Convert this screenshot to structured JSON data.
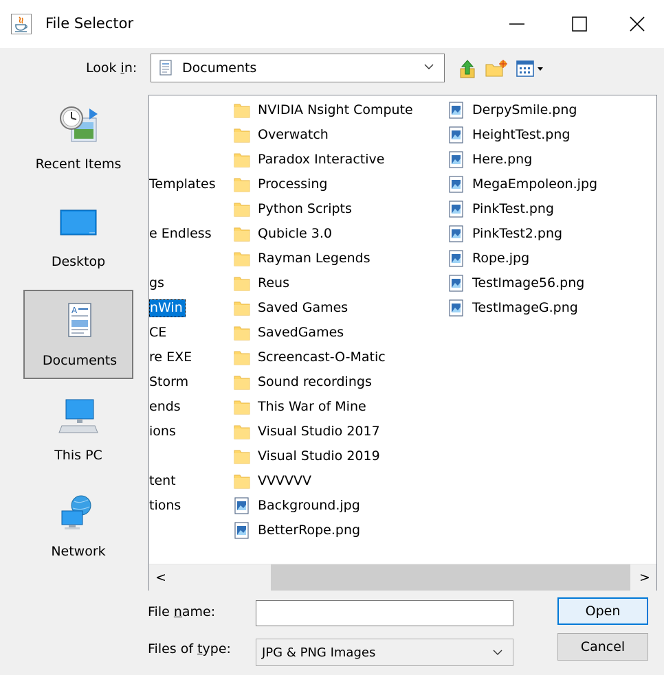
{
  "window": {
    "title": "File Selector",
    "minimize": "—",
    "maximize": "☐",
    "close": "✕"
  },
  "toolbar": {
    "look_in_pre": "Look ",
    "look_in_mnemonic": "i",
    "look_in_post": "n:",
    "look_in_value": "Documents",
    "icons": [
      "up-one-level-icon",
      "new-folder-icon",
      "view-menu-icon"
    ]
  },
  "places": [
    {
      "label": "Recent Items",
      "icon": "recent-items-icon"
    },
    {
      "label": "Desktop",
      "icon": "desktop-icon"
    },
    {
      "label": "Documents",
      "icon": "documents-icon",
      "selected": true
    },
    {
      "label": "This PC",
      "icon": "this-pc-icon"
    },
    {
      "label": "Network",
      "icon": "network-icon"
    }
  ],
  "file_list": {
    "partial_column": [
      {
        "text": " Templates",
        "y": 0
      },
      {
        "text": "e Endless",
        "y": 0
      },
      {
        "text": "gs",
        "y": 0
      },
      {
        "text": "nWin",
        "y": 0,
        "selected": true
      },
      {
        "text": "CE",
        "y": 0
      },
      {
        "text": "re EXE",
        "y": 0
      },
      {
        "text": "Storm",
        "y": 0
      },
      {
        "text": "ends",
        "y": 0
      },
      {
        "text": "ions",
        "y": 0
      },
      {
        "text": "tent",
        "y": 0
      },
      {
        "text": "tions",
        "y": 0
      }
    ],
    "column2": [
      {
        "name": "NVIDIA Nsight Compute",
        "type": "folder"
      },
      {
        "name": "Overwatch",
        "type": "folder"
      },
      {
        "name": "Paradox Interactive",
        "type": "folder"
      },
      {
        "name": "Processing",
        "type": "folder"
      },
      {
        "name": "Python Scripts",
        "type": "folder"
      },
      {
        "name": "Qubicle 3.0",
        "type": "folder"
      },
      {
        "name": "Rayman Legends",
        "type": "folder"
      },
      {
        "name": "Reus",
        "type": "folder"
      },
      {
        "name": "Saved Games",
        "type": "folder"
      },
      {
        "name": "SavedGames",
        "type": "folder"
      },
      {
        "name": "Screencast-O-Matic",
        "type": "folder"
      },
      {
        "name": "Sound recordings",
        "type": "folder"
      },
      {
        "name": "This War of Mine",
        "type": "folder"
      },
      {
        "name": "Visual Studio 2017",
        "type": "folder"
      },
      {
        "name": "Visual Studio 2019",
        "type": "folder"
      },
      {
        "name": "VVVVVV",
        "type": "folder"
      },
      {
        "name": "Background.jpg",
        "type": "image"
      },
      {
        "name": "BetterRope.png",
        "type": "image"
      }
    ],
    "column3": [
      {
        "name": "DerpySmile.png",
        "type": "image"
      },
      {
        "name": "HeightTest.png",
        "type": "image"
      },
      {
        "name": "Here.png",
        "type": "image"
      },
      {
        "name": "MegaEmpoleon.jpg",
        "type": "image"
      },
      {
        "name": "PinkTest.png",
        "type": "image"
      },
      {
        "name": "PinkTest2.png",
        "type": "image"
      },
      {
        "name": "Rope.jpg",
        "type": "image"
      },
      {
        "name": "TestImage56.png",
        "type": "image"
      },
      {
        "name": "TestImageG.png",
        "type": "image"
      }
    ],
    "scroll_left": "<",
    "scroll_right": ">"
  },
  "bottom": {
    "file_name_pre": "File ",
    "file_name_mnemonic": "n",
    "file_name_post": "ame:",
    "file_name_value": "",
    "files_of_type_pre": "Files of ",
    "files_of_type_mnemonic": "t",
    "files_of_type_post": "ype:",
    "files_of_type_value": "JPG & PNG Images",
    "open_label": "Open",
    "cancel_label": "Cancel"
  },
  "colors": {
    "selection": "#0078d7",
    "folder": "#ffd768",
    "background": "#f0f0f0"
  }
}
